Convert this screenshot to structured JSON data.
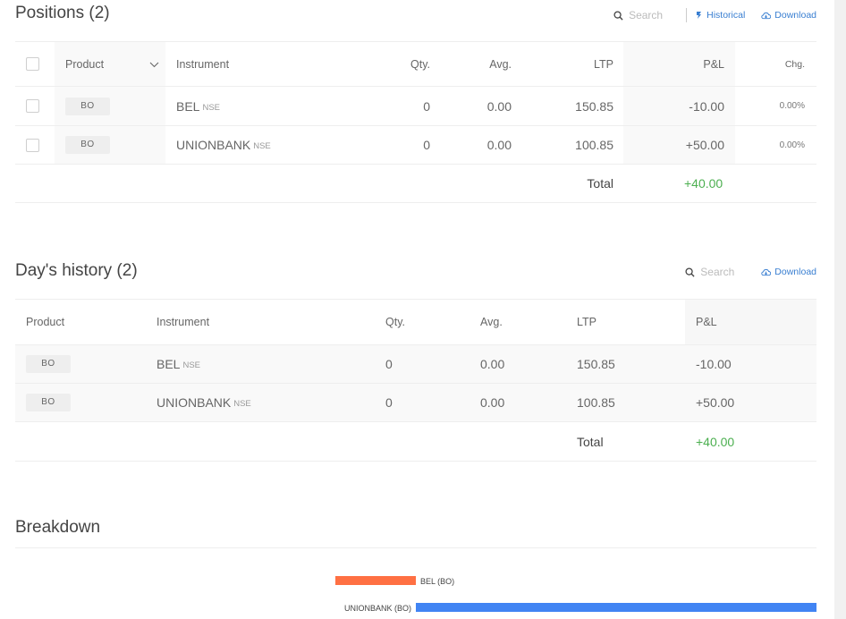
{
  "positions": {
    "title": "Positions (2)",
    "search_placeholder": "Search",
    "historical_label": "Historical",
    "download_label": "Download",
    "columns": {
      "product": "Product",
      "instrument": "Instrument",
      "qty": "Qty.",
      "avg": "Avg.",
      "ltp": "LTP",
      "pnl": "P&L",
      "chg": "Chg."
    },
    "rows": [
      {
        "product": "BO",
        "symbol": "BEL",
        "exchange": "NSE",
        "qty": "0",
        "avg": "0.00",
        "ltp": "150.85",
        "pnl": "-10.00",
        "chg": "0.00%"
      },
      {
        "product": "BO",
        "symbol": "UNIONBANK",
        "exchange": "NSE",
        "qty": "0",
        "avg": "0.00",
        "ltp": "100.85",
        "pnl": "+50.00",
        "chg": "0.00%"
      }
    ],
    "total_label": "Total",
    "total_value": "+40.00"
  },
  "history": {
    "title": "Day's history (2)",
    "search_placeholder": "Search",
    "download_label": "Download",
    "columns": {
      "product": "Product",
      "instrument": "Instrument",
      "qty": "Qty.",
      "avg": "Avg.",
      "ltp": "LTP",
      "pnl": "P&L"
    },
    "rows": [
      {
        "product": "BO",
        "symbol": "BEL",
        "exchange": "NSE",
        "qty": "0",
        "avg": "0.00",
        "ltp": "150.85",
        "pnl": "-10.00"
      },
      {
        "product": "BO",
        "symbol": "UNIONBANK",
        "exchange": "NSE",
        "qty": "0",
        "avg": "0.00",
        "ltp": "100.85",
        "pnl": "+50.00"
      }
    ],
    "total_label": "Total",
    "total_value": "+40.00"
  },
  "breakdown": {
    "title": "Breakdown",
    "bars": [
      {
        "label": "BEL (BO)",
        "value": -10.0
      },
      {
        "label": "UNIONBANK (BO)",
        "value": 50.0
      }
    ]
  },
  "colors": {
    "negative_bar": "#ff7043",
    "positive_bar": "#4184f3",
    "positive_text": "#4caf50",
    "link": "#387ed1"
  }
}
